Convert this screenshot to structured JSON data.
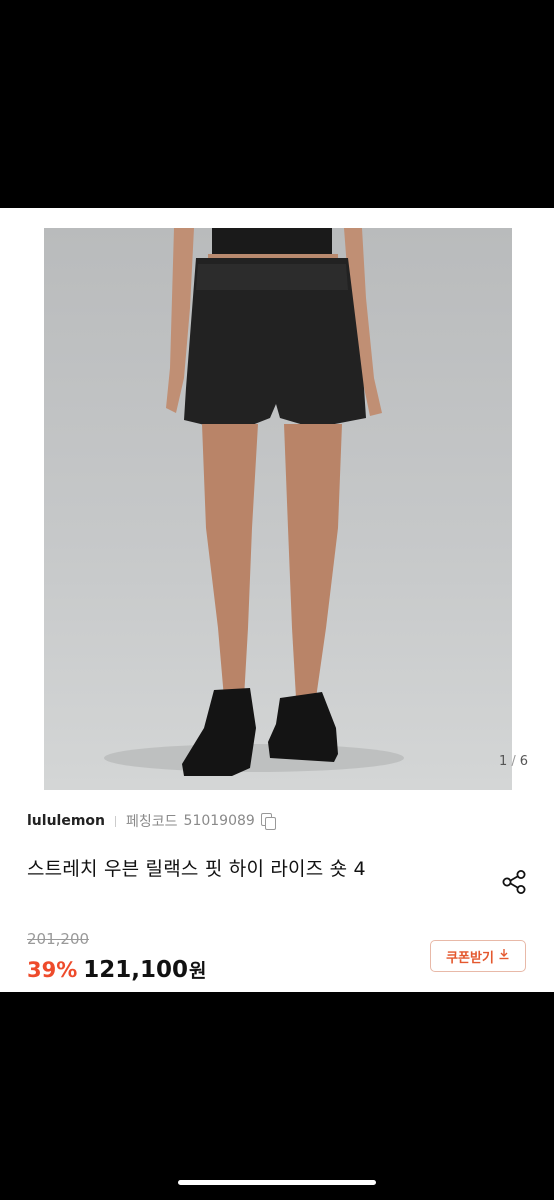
{
  "gallery": {
    "current": "1",
    "separator": "/",
    "total": "6"
  },
  "product": {
    "brand": "lululemon",
    "code_label": "페칭코드",
    "code_value": "51019089",
    "title": "스트레치 우븐 릴랙스 핏 하이 라이즈 숏 4"
  },
  "pricing": {
    "original": "201,200",
    "discount": "39%",
    "price": "121,100",
    "currency": "원"
  },
  "coupon": {
    "label": "쿠폰받기"
  },
  "icons": {
    "copy": "copy-icon",
    "share": "share-icon",
    "download": "download-icon"
  },
  "colors": {
    "accent": "#ee4b2b",
    "coupon_text": "#e4582e",
    "coupon_border": "#e8b9a8"
  }
}
